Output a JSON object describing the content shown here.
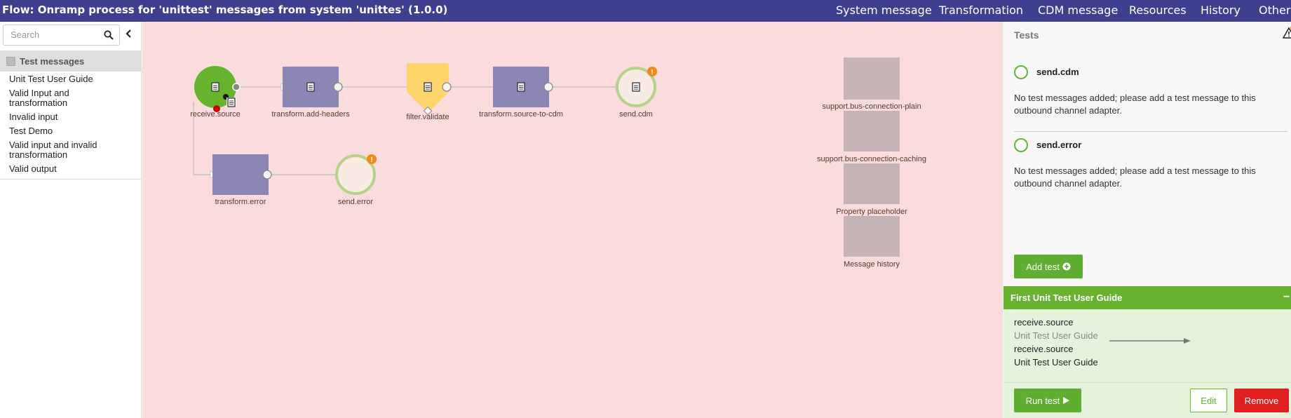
{
  "header": {
    "title": "Flow: Onramp process for 'unittest' messages from system 'unittes' (1.0.0)",
    "nav": [
      "System message",
      "Transformation",
      "CDM message",
      "Resources",
      "History",
      "Other"
    ]
  },
  "sidebar": {
    "search_placeholder": "Search",
    "section_title": "Test messages",
    "items": [
      "Unit Test User Guide",
      "Valid Input and transformation",
      "Invalid input",
      "Test Demo",
      "Valid input and invalid transformation",
      "Valid output"
    ]
  },
  "flow": {
    "nodes": {
      "receive_source": "receive.source",
      "transform_add_headers": "transform.add-headers",
      "filter_validate": "filter.validate",
      "transform_source_to_cdm": "transform.source-to-cdm",
      "send_cdm": "send.cdm",
      "transform_error": "transform.error",
      "send_error": "send.error"
    },
    "resources": [
      "support.bus-connection-plain",
      "support.bus-connection-caching",
      "Property placeholder",
      "Message history"
    ]
  },
  "tests_panel": {
    "title": "Tests",
    "adapters": [
      {
        "name": "send.cdm",
        "message": "No test messages added; please add a test message to this outbound channel adapter."
      },
      {
        "name": "send.error",
        "message": "No test messages added; please add a test message to this outbound channel adapter."
      }
    ],
    "add_test_label": "Add test",
    "test_case": {
      "title": "First Unit Test User Guide",
      "lines": [
        "receive.source",
        "Unit Test User Guide",
        "receive.source",
        "Unit Test User Guide"
      ],
      "run_label": "Run test",
      "edit_label": "Edit",
      "remove_label": "Remove"
    }
  },
  "colors": {
    "topbar": "#3f3f8f",
    "canvas": "#fadcdd",
    "green": "#67b32f",
    "transformer": "#8c86b4",
    "filter": "#fdd56a",
    "resource": "#c4b4b5",
    "remove": "#e02020"
  }
}
